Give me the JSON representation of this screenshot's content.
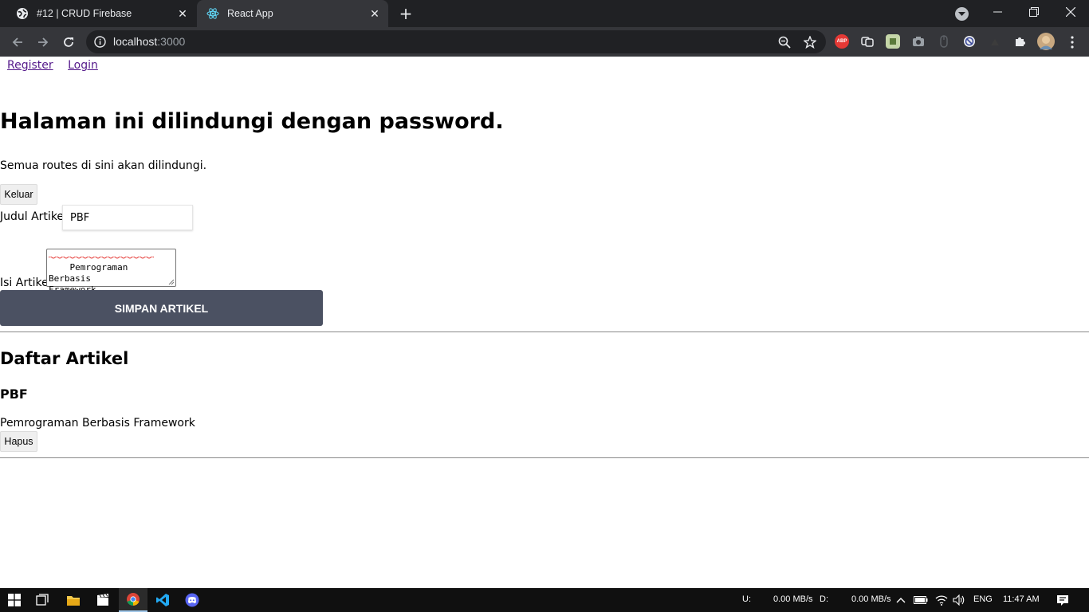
{
  "browser": {
    "tabs": [
      {
        "title": "#12 | CRUD Firebase",
        "active": false,
        "icon": "globe-icon"
      },
      {
        "title": "React App",
        "active": true,
        "icon": "react-icon"
      }
    ],
    "url_host": "localhost",
    "url_port": ":3000",
    "extensions": [
      "adblock-plus-icon",
      "sync-icon",
      "extension-green-icon",
      "camera-icon",
      "mouse-icon",
      "blocker-icon",
      "puzzle-icon"
    ]
  },
  "page": {
    "nav": {
      "register": "Register",
      "login": "Login"
    },
    "heading": "Halaman ini dilindungi dengan password.",
    "description": "Semua routes di sini akan dilindungi.",
    "logout_label": "Keluar",
    "form": {
      "title_label": "Judul Artikel",
      "title_value": "PBF",
      "content_label": "Isi Artikel",
      "content_value": "Pemrograman Berbasis\nFramework",
      "submit_label": "SIMPAN ARTIKEL"
    },
    "list": {
      "heading": "Daftar Artikel",
      "articles": [
        {
          "title": "PBF",
          "body": "Pemrograman Berbasis Framework",
          "delete_label": "Hapus"
        }
      ]
    }
  },
  "taskbar": {
    "upload_label": "U:",
    "upload_value": "0.00 MB/s",
    "download_label": "D:",
    "download_value": "0.00 MB/s",
    "language": "ENG",
    "time": "11:47 AM"
  },
  "colors": {
    "chrome_dark": "#202124",
    "chrome_toolbar": "#35363a",
    "submit_bg": "#4b5162",
    "link": "#551a8b"
  }
}
